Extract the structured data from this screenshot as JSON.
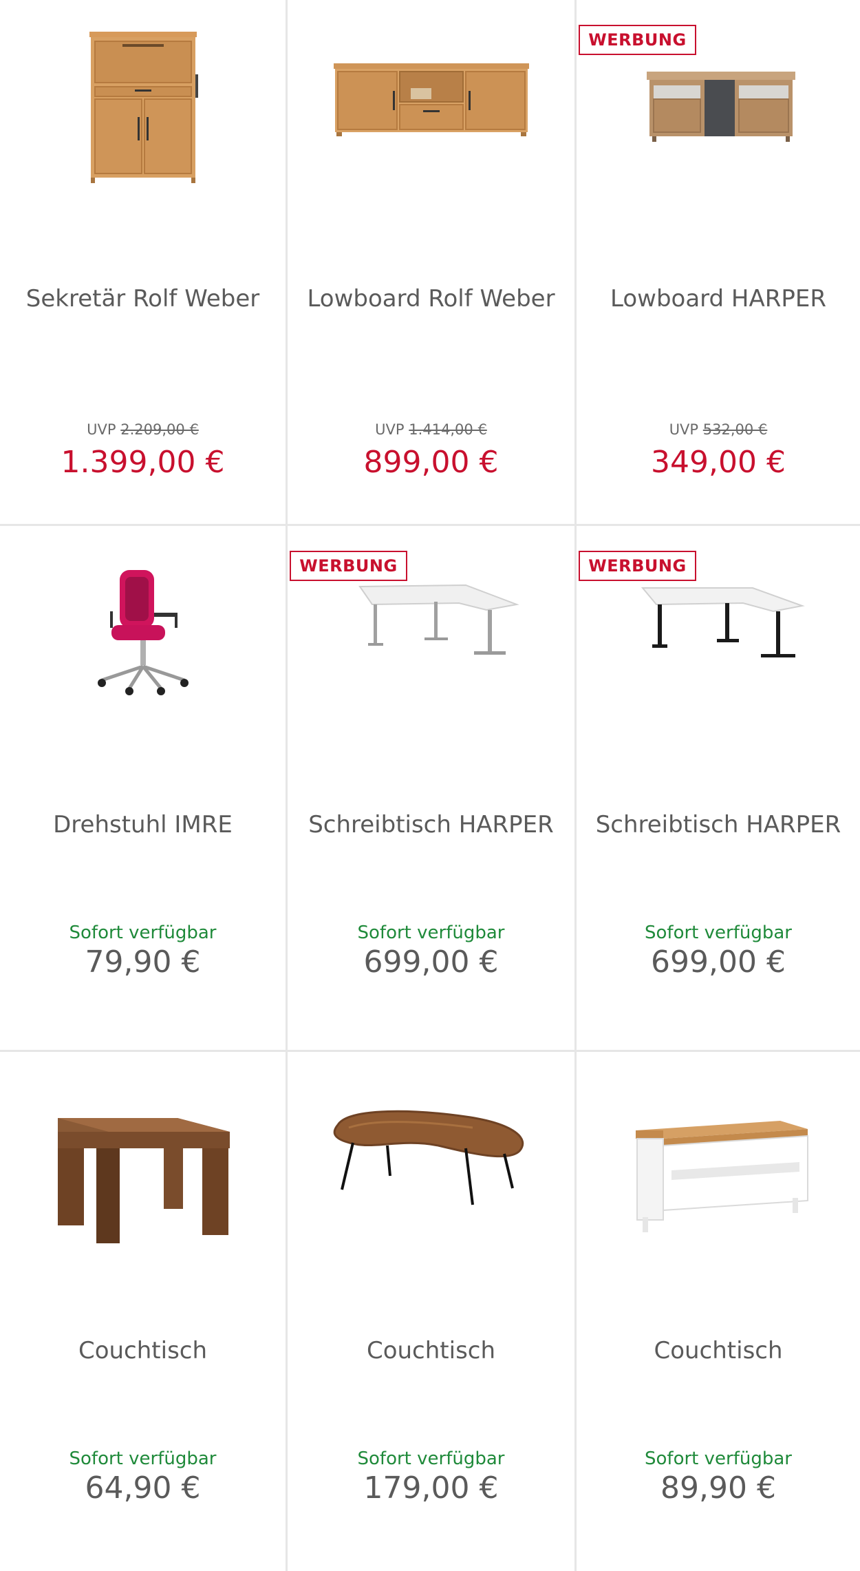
{
  "products": [
    {
      "name": "Sekretär Rolf Weber",
      "uvp_label": "UVP",
      "uvp_price": "2.209,00 €",
      "price": "1.399,00 €",
      "sale": true,
      "badge": "",
      "icon": "secretary-cabinet"
    },
    {
      "name": "Lowboard Rolf Weber",
      "uvp_label": "UVP",
      "uvp_price": "1.414,00 €",
      "price": "899,00 €",
      "sale": true,
      "badge": "",
      "icon": "lowboard-oak"
    },
    {
      "name": "Lowboard HARPER",
      "uvp_label": "UVP",
      "uvp_price": "532,00 €",
      "price": "349,00 €",
      "sale": true,
      "badge": "WERBUNG",
      "icon": "lowboard-harper"
    },
    {
      "name": "Drehstuhl IMRE",
      "stock": "Sofort verfügbar",
      "price": "79,90 €",
      "sale": false,
      "badge": "",
      "icon": "swivel-chair"
    },
    {
      "name": "Schreibtisch HARPER",
      "stock": "Sofort verfügbar",
      "price": "699,00 €",
      "sale": false,
      "badge": "WERBUNG",
      "icon": "corner-desk-silver"
    },
    {
      "name": "Schreibtisch HARPER",
      "stock": "Sofort verfügbar",
      "price": "699,00 €",
      "sale": false,
      "badge": "WERBUNG",
      "icon": "corner-desk-black"
    },
    {
      "name": "Couchtisch",
      "stock": "Sofort verfügbar",
      "price": "64,90 €",
      "sale": false,
      "badge": "",
      "icon": "side-table-wood"
    },
    {
      "name": "Couchtisch",
      "stock": "Sofort verfügbar",
      "price": "179,00 €",
      "sale": false,
      "badge": "",
      "icon": "kidney-coffee-table"
    },
    {
      "name": "Couchtisch",
      "stock": "Sofort verfügbar",
      "price": "89,90 €",
      "sale": false,
      "badge": "",
      "icon": "coffee-table-white"
    }
  ],
  "colors": {
    "sale_price": "#c8102e",
    "badge": "#c8102e",
    "stock": "#1f8a3a",
    "text": "#5a5a5a",
    "divider": "#e6e6e6"
  }
}
